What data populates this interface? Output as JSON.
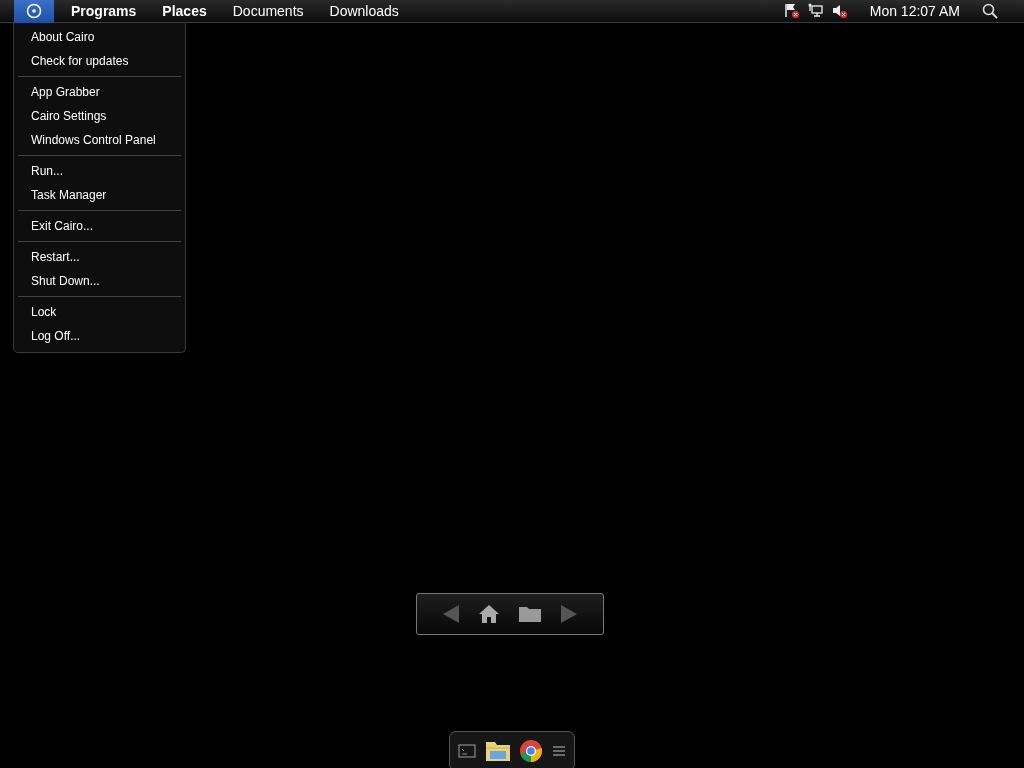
{
  "menu_bar": {
    "start_button": {
      "selected": true
    },
    "menus": [
      {
        "label": "Programs",
        "kind": "category"
      },
      {
        "label": "Places",
        "kind": "category"
      },
      {
        "label": "Documents",
        "kind": "folder"
      },
      {
        "label": "Downloads",
        "kind": "folder"
      }
    ],
    "tray_icons": [
      {
        "kind": "flag",
        "error": true
      },
      {
        "kind": "network",
        "error": false
      },
      {
        "kind": "volume",
        "error": true
      }
    ],
    "clock": "Mon 12:07 AM"
  },
  "start_menu": {
    "groups": [
      [
        "About Cairo",
        "Check for updates"
      ],
      [
        "App Grabber",
        "Cairo Settings",
        "Windows Control Panel"
      ],
      [
        "Run...",
        "Task Manager"
      ],
      [
        "Exit Cairo..."
      ],
      [
        "Restart...",
        "Shut Down..."
      ],
      [
        "Lock",
        "Log Off..."
      ]
    ]
  },
  "dock": {
    "apps": [
      {
        "kind": "terminal"
      },
      {
        "kind": "explorer"
      },
      {
        "kind": "chrome"
      },
      {
        "kind": "menu"
      }
    ]
  }
}
